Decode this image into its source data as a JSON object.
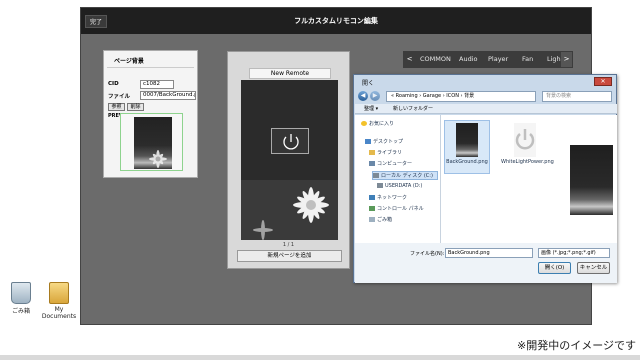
{
  "desktop": {
    "icons": [
      {
        "label": "ごみ箱"
      },
      {
        "label": "My Documents"
      }
    ]
  },
  "app": {
    "done_label": "完了",
    "title": "フルカスタムリモコン編集"
  },
  "bg_panel": {
    "title": "ページ背景",
    "cid_label": "CID",
    "cid_value": "c1082",
    "file_label": "ファイル",
    "file_value": "0007/BackGround.p",
    "browse_label": "参照",
    "delete_label": "削除",
    "preview_label": "PREVIEW"
  },
  "phone": {
    "remote_name": "New Remote",
    "page_indicator": "1 / 1",
    "add_page_label": "新規ページを追加"
  },
  "tabs": {
    "prev": "<",
    "next": ">",
    "items": [
      "COMMON",
      "Audio",
      "Player",
      "Fan",
      "Ligh"
    ]
  },
  "dialog": {
    "title": "開く",
    "close": "✕",
    "path": "« Roaming › Garage › ICON › 背景",
    "search_placeholder": "背景の検索",
    "organize": "整理 ▾",
    "new_folder": "新しいフォルダー",
    "tree": [
      "お気に入り",
      "デスクトップ",
      "ライブラリ",
      "コンピューター",
      "ローカル ディスク (C:)",
      "USERDATA (D:)",
      "ネットワーク",
      "コントロール パネル",
      "ごみ箱"
    ],
    "files": [
      {
        "name": "BackGround.png",
        "selected": true
      },
      {
        "name": "WhiteLightPower.png",
        "selected": false
      }
    ],
    "filename_label": "ファイル名(N):",
    "filename_value": "BackGround.png",
    "filetype_value": "画像 (*.jpg;*.png;*.gif)",
    "open_label": "開く(O)",
    "cancel_label": "キャンセル"
  },
  "footer": {
    "note": "※開発中のイメージです"
  },
  "colors": {
    "app_bg": "#6b6b6b",
    "header_bg": "#1f1f1f",
    "tabs_bg": "#3c3c3c",
    "dialog_frame": "#c9d9ea"
  }
}
